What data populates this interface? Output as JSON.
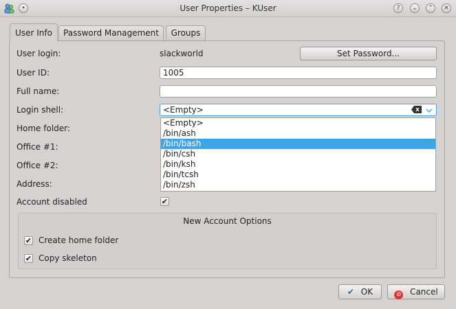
{
  "window": {
    "title": "User Properties – KUser"
  },
  "tabs": [
    {
      "label": "User Info",
      "active": true
    },
    {
      "label": "Password Management",
      "active": false
    },
    {
      "label": "Groups",
      "active": false
    }
  ],
  "form": {
    "user_login_label": "User login:",
    "user_login_value": "slackworld",
    "set_password_label": "Set Password...",
    "user_id_label": "User ID:",
    "user_id_value": "1005",
    "full_name_label": "Full name:",
    "full_name_value": "",
    "login_shell_label": "Login shell:",
    "login_shell_value": "<Empty>",
    "home_folder_label": "Home folder:",
    "office1_label": "Office #1:",
    "office2_label": "Office #2:",
    "address_label": "Address:",
    "account_disabled_label": "Account disabled",
    "account_disabled_checked": true
  },
  "shell_options": [
    "<Empty>",
    "/bin/ash",
    "/bin/bash",
    "/bin/csh",
    "/bin/ksh",
    "/bin/tcsh",
    "/bin/zsh"
  ],
  "shell_highlighted": "/bin/bash",
  "new_account": {
    "title": "New Account Options",
    "create_home_label": "Create home folder",
    "copy_skeleton_label": "Copy skeleton"
  },
  "buttons": {
    "ok": "OK",
    "cancel": "Cancel"
  },
  "colors": {
    "highlight": "#3ea4e6",
    "window_bg": "#d6d2d0"
  },
  "icons": [
    "app-icon",
    "help-icon",
    "minimize-icon",
    "maximize-icon",
    "close-icon",
    "clear-text-icon",
    "chevron-down-icon",
    "check-icon",
    "ok-icon",
    "cancel-icon"
  ]
}
